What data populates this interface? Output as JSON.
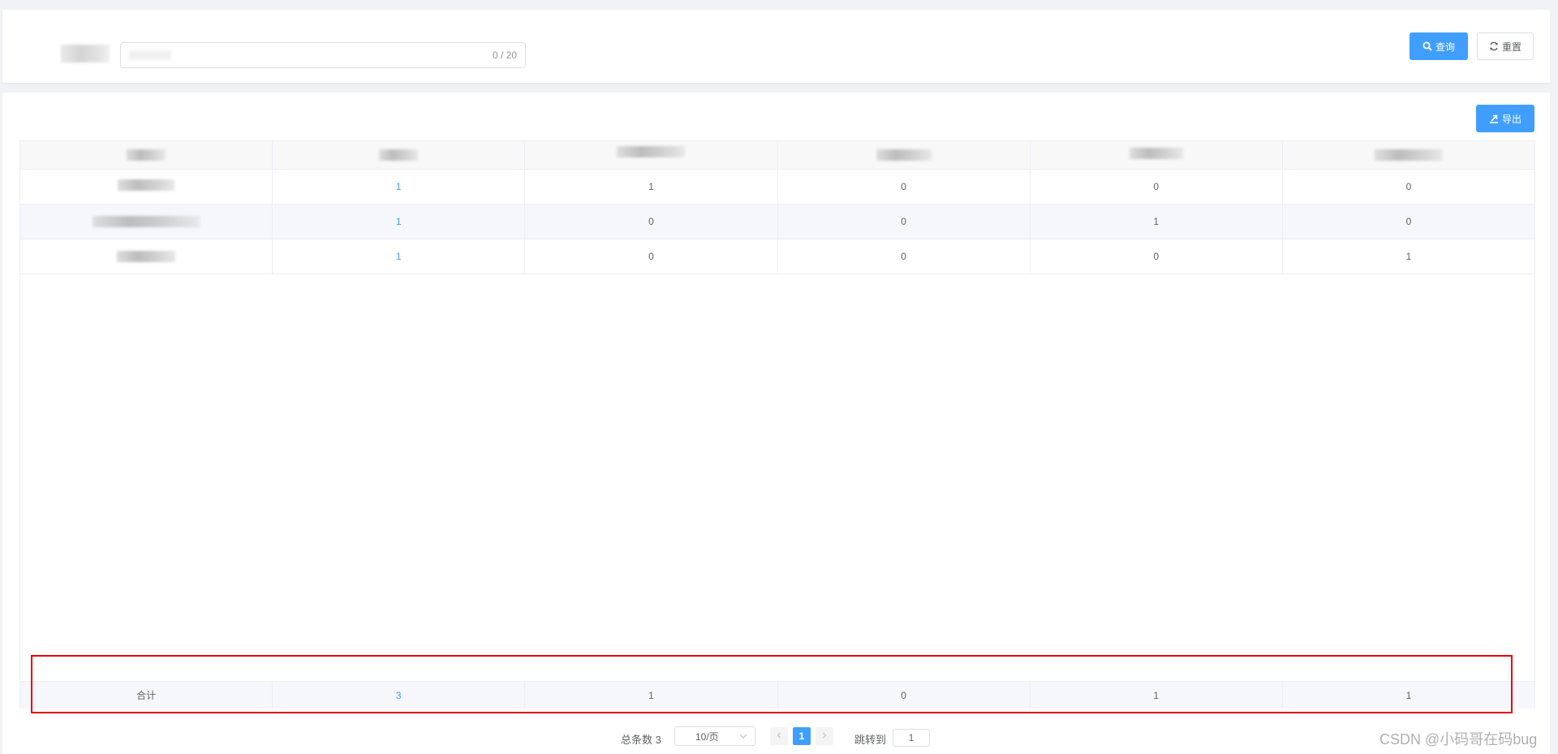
{
  "search": {
    "counter": "0 / 20",
    "query_label": "查询",
    "reset_label": "重置"
  },
  "toolbar": {
    "export_label": "导出"
  },
  "table": {
    "rows": [
      [
        "1",
        "1",
        "0",
        "0",
        "0"
      ],
      [
        "1",
        "0",
        "0",
        "1",
        "0"
      ],
      [
        "1",
        "0",
        "0",
        "0",
        "1"
      ]
    ],
    "footer": {
      "label": "合计",
      "values": [
        "3",
        "1",
        "0",
        "1",
        "1"
      ]
    }
  },
  "pagination": {
    "total": "总条数 3",
    "page_size": "10/页",
    "current_page": "1",
    "jump_label": "跳转到",
    "jump_value": "1"
  },
  "watermark": "CSDN @小码哥在码bug",
  "colors": {
    "primary": "#409eff",
    "highlight_box": "#e60000"
  }
}
